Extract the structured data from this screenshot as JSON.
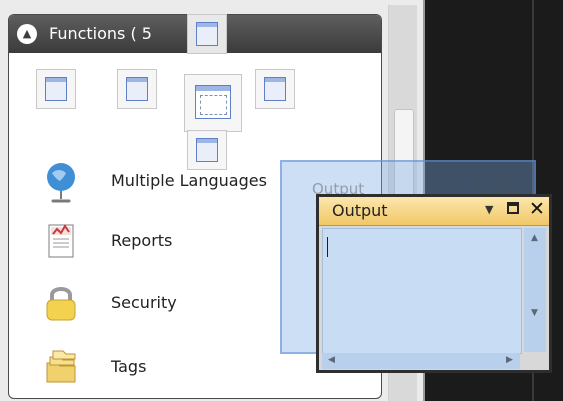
{
  "panel": {
    "title": "Functions ( 5",
    "collapse_icon": "chevron-up-icon",
    "items": [
      {
        "label": "Multiple Languages",
        "icon": "globe-icon"
      },
      {
        "label": "Reports",
        "icon": "report-icon"
      },
      {
        "label": "Security",
        "icon": "padlock-icon"
      },
      {
        "label": "Tags",
        "icon": "folder-stack-icon"
      }
    ]
  },
  "dock_guide": {
    "buttons": [
      "dock-top",
      "dock-left",
      "dock-center",
      "dock-right",
      "dock-bottom",
      "dock-left-outer"
    ]
  },
  "output_window": {
    "title": "Output",
    "ghost_title": "Output",
    "controls": {
      "dropdown_icon": "dropdown-arrow-icon",
      "maximize_icon": "maximize-icon",
      "close_icon": "close-icon",
      "close_glyph": "✕",
      "ghost_glyph": "▾ ☐ ✕"
    }
  },
  "colors": {
    "panel_header": "#4a4a4a",
    "output_title": "#f1c766",
    "output_area": "#c8ddf4",
    "dock_glyph": "#5f80c8"
  }
}
